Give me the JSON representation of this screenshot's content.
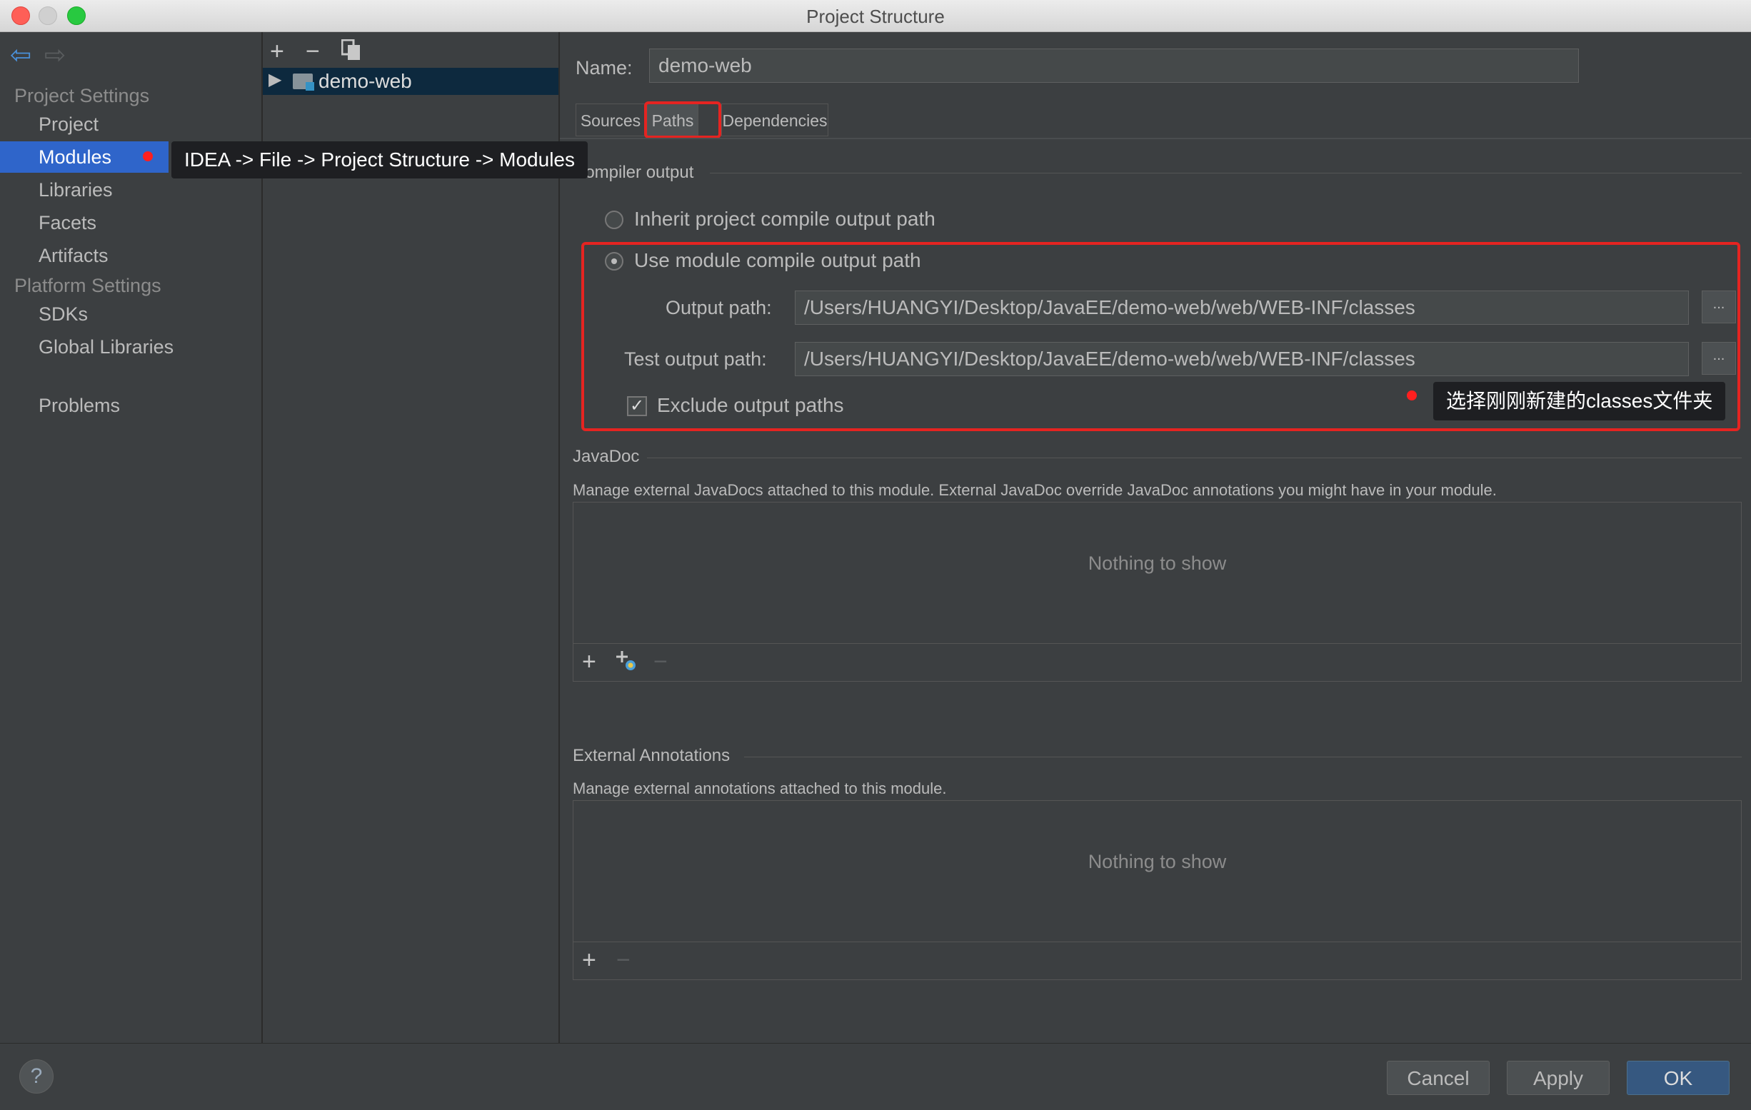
{
  "window": {
    "title": "Project Structure"
  },
  "colors": {
    "selection": "#2f65ca",
    "annotation_red": "#e52421",
    "panel_bg": "#3c3f41",
    "ok_button": "#365880"
  },
  "sidebar": {
    "back_icon": "arrow-left-icon",
    "forward_icon": "arrow-right-icon",
    "project_settings": "Project Settings",
    "items": [
      {
        "label": "Project",
        "selected": false
      },
      {
        "label": "Modules",
        "selected": true
      },
      {
        "label": "Libraries",
        "selected": false
      },
      {
        "label": "Facets",
        "selected": false
      },
      {
        "label": "Artifacts",
        "selected": false
      }
    ],
    "platform_settings": "Platform Settings",
    "platform_items": [
      {
        "label": "SDKs"
      },
      {
        "label": "Global Libraries"
      }
    ],
    "problems": "Problems"
  },
  "tree": {
    "toolbar": {
      "add": "+",
      "remove": "−",
      "copy_icon": "copy-icon"
    },
    "module": "demo-web"
  },
  "annotations": {
    "modules_hint": "IDEA -> File -> Project Structure -> Modules",
    "classes_hint": "选择刚刚新建的classes文件夹"
  },
  "main": {
    "name_label": "Name:",
    "name_value": "demo-web",
    "tabs": [
      {
        "label": "Sources",
        "active": false
      },
      {
        "label": "Paths",
        "active": true
      },
      {
        "label": "Dependencies",
        "active": false
      }
    ],
    "compiler_output": {
      "title": "Compiler output",
      "inherit_label": "Inherit project compile output path",
      "inherit_selected": false,
      "use_module_label": "Use module compile output path",
      "use_module_selected": true,
      "output_path_label": "Output path:",
      "output_path": "/Users/HUANGYI/Desktop/JavaEE/demo-web/web/WEB-INF/classes",
      "test_output_path_label": "Test output path:",
      "test_output_path": "/Users/HUANGYI/Desktop/JavaEE/demo-web/web/WEB-INF/classes",
      "browse": "...",
      "exclude_label": "Exclude output paths",
      "exclude_checked": true
    },
    "javadoc": {
      "title": "JavaDoc",
      "description": "Manage external JavaDocs attached to this module. External JavaDoc override JavaDoc annotations you might have in your module.",
      "empty": "Nothing to show",
      "add": "+",
      "remove": "−"
    },
    "external_annotations": {
      "title": "External Annotations",
      "description": "Manage external annotations attached to this module.",
      "empty": "Nothing to show",
      "add": "+",
      "remove": "−"
    }
  },
  "footer": {
    "help": "?",
    "cancel": "Cancel",
    "apply": "Apply",
    "ok": "OK"
  }
}
